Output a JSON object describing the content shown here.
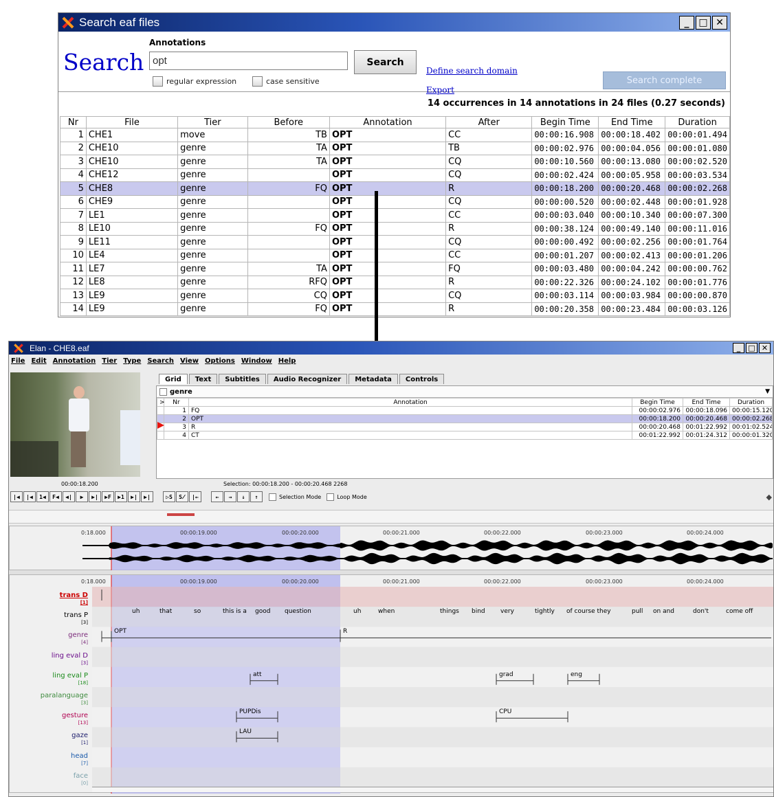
{
  "search_window": {
    "title": "Search eaf files",
    "search_heading": "Search",
    "annotations_label": "Annotations",
    "query_value": "opt",
    "regex_label": "regular expression",
    "case_label": "case sensitive",
    "search_button": "Search",
    "define_domain_link": "Define search domain",
    "export_link": "Export",
    "status_button": "Search complete",
    "summary": "14 occurrences in 14 annotations  in 24 files (0.27 seconds)",
    "columns": [
      "Nr",
      "File",
      "Tier",
      "Before",
      "Annotation",
      "After",
      "Begin Time",
      "End Time",
      "Duration"
    ],
    "rows": [
      [
        "1",
        "CHE1",
        "move",
        "TB",
        "OPT",
        "CC",
        "00:00:16.908",
        "00:00:18.402",
        "00:00:01.494"
      ],
      [
        "2",
        "CHE10",
        "genre",
        "TA",
        "OPT",
        "TB",
        "00:00:02.976",
        "00:00:04.056",
        "00:00:01.080"
      ],
      [
        "3",
        "CHE10",
        "genre",
        "TA",
        "OPT",
        "CQ",
        "00:00:10.560",
        "00:00:13.080",
        "00:00:02.520"
      ],
      [
        "4",
        "CHE12",
        "genre",
        "",
        "OPT",
        "CQ",
        "00:00:02.424",
        "00:00:05.958",
        "00:00:03.534"
      ],
      [
        "5",
        "CHE8",
        "genre",
        "FQ",
        "OPT",
        "R",
        "00:00:18.200",
        "00:00:20.468",
        "00:00:02.268"
      ],
      [
        "6",
        "CHE9",
        "genre",
        "",
        "OPT",
        "CQ",
        "00:00:00.520",
        "00:00:02.448",
        "00:00:01.928"
      ],
      [
        "7",
        "LE1",
        "genre",
        "",
        "OPT",
        "CC",
        "00:00:03.040",
        "00:00:10.340",
        "00:00:07.300"
      ],
      [
        "8",
        "LE10",
        "genre",
        "FQ",
        "OPT",
        "R",
        "00:00:38.124",
        "00:00:49.140",
        "00:00:11.016"
      ],
      [
        "9",
        "LE11",
        "genre",
        "",
        "OPT",
        "CQ",
        "00:00:00.492",
        "00:00:02.256",
        "00:00:01.764"
      ],
      [
        "10",
        "LE4",
        "genre",
        "",
        "OPT",
        "CC",
        "00:00:01.207",
        "00:00:02.413",
        "00:00:01.206"
      ],
      [
        "11",
        "LE7",
        "genre",
        "TA",
        "OPT",
        "FQ",
        "00:00:03.480",
        "00:00:04.242",
        "00:00:00.762"
      ],
      [
        "12",
        "LE8",
        "genre",
        "RFQ",
        "OPT",
        "R",
        "00:00:22.326",
        "00:00:24.102",
        "00:00:01.776"
      ],
      [
        "13",
        "LE9",
        "genre",
        "CQ",
        "OPT",
        "CQ",
        "00:00:03.114",
        "00:00:03.984",
        "00:00:00.870"
      ],
      [
        "14",
        "LE9",
        "genre",
        "FQ",
        "OPT",
        "R",
        "00:00:20.358",
        "00:00:23.484",
        "00:00:03.126"
      ]
    ],
    "selected_row": 4
  },
  "elan": {
    "title": "Elan - CHE8.eaf",
    "menu": [
      "File",
      "Edit",
      "Annotation",
      "Tier",
      "Type",
      "Search",
      "View",
      "Options",
      "Window",
      "Help"
    ],
    "tabs": [
      "Grid",
      "Text",
      "Subtitles",
      "Audio Recognizer",
      "Metadata",
      "Controls"
    ],
    "grid_tier": "genre",
    "grid_columns": [
      ">",
      "Nr",
      "Annotation",
      "Begin Time",
      "End Time",
      "Duration"
    ],
    "grid_rows": [
      [
        "",
        "1",
        "FQ",
        "00:00:02.976",
        "00:00:18.096",
        "00:00:15.120"
      ],
      [
        "",
        "2",
        "OPT",
        "00:00:18.200",
        "00:00:20.468",
        "00:00:02.268"
      ],
      [
        "",
        "3",
        "R",
        "00:00:20.468",
        "00:01:22.992",
        "00:01:02.524"
      ],
      [
        "",
        "4",
        "CT",
        "00:01:22.992",
        "00:01:24.312",
        "00:00:01.320"
      ]
    ],
    "grid_selected": 1,
    "current_time": "00:00:18.200",
    "selection": "Selection: 00:00:18.200 - 00:00:20.468  2268",
    "controls": [
      "|◀",
      "|◀",
      "1◀",
      "F◀",
      "◀|",
      "▶",
      "▶|",
      "▶F",
      "▶1",
      "▶|",
      "▶|"
    ],
    "controls2": [
      "▷S",
      "S̸",
      "|←"
    ],
    "controls3": [
      "←",
      "→",
      "↓",
      "↑"
    ],
    "selection_mode": "Selection Mode",
    "loop_mode": "Loop Mode",
    "ruler_ticks": [
      "0:18.000",
      "00:00:19.000",
      "00:00:20.000",
      "00:00:21.000",
      "00:00:22.000",
      "00:00:23.000",
      "00:00:24.000"
    ],
    "tiers": [
      {
        "name": "trans D",
        "count": "[1]",
        "color": "#cc0000"
      },
      {
        "name": "trans P",
        "count": "[3]",
        "color": "#000000"
      },
      {
        "name": "genre",
        "count": "[4]",
        "color": "#7a2a7a"
      },
      {
        "name": "ling eval D",
        "count": "[3]",
        "color": "#6a0d8a"
      },
      {
        "name": "ling eval P",
        "count": "[18]",
        "color": "#1a8a1a"
      },
      {
        "name": "paralanguage",
        "count": "[3]",
        "color": "#3d8a3d"
      },
      {
        "name": "gesture",
        "count": "[13]",
        "color": "#b00050"
      },
      {
        "name": "gaze",
        "count": "[1]",
        "color": "#1a1a6a"
      },
      {
        "name": "head",
        "count": "[7]",
        "color": "#1a5aaa"
      },
      {
        "name": "face",
        "count": "[0]",
        "color": "#7aa0aa"
      }
    ],
    "trans_p_words": [
      "uh",
      "that",
      "so",
      "this is a",
      "good",
      "question",
      "uh",
      "when",
      "things",
      "bind",
      "very",
      "tightly",
      "of course they",
      "pull",
      "on and",
      "don't",
      "come off"
    ],
    "genre_annotations": [
      "OPT",
      "R"
    ],
    "ling_eval_p_annotations": [
      "att",
      "grad",
      "eng"
    ],
    "gesture_annotations": [
      "PUPDis",
      "CPU"
    ],
    "gaze_annotations": [
      "LAU"
    ]
  }
}
